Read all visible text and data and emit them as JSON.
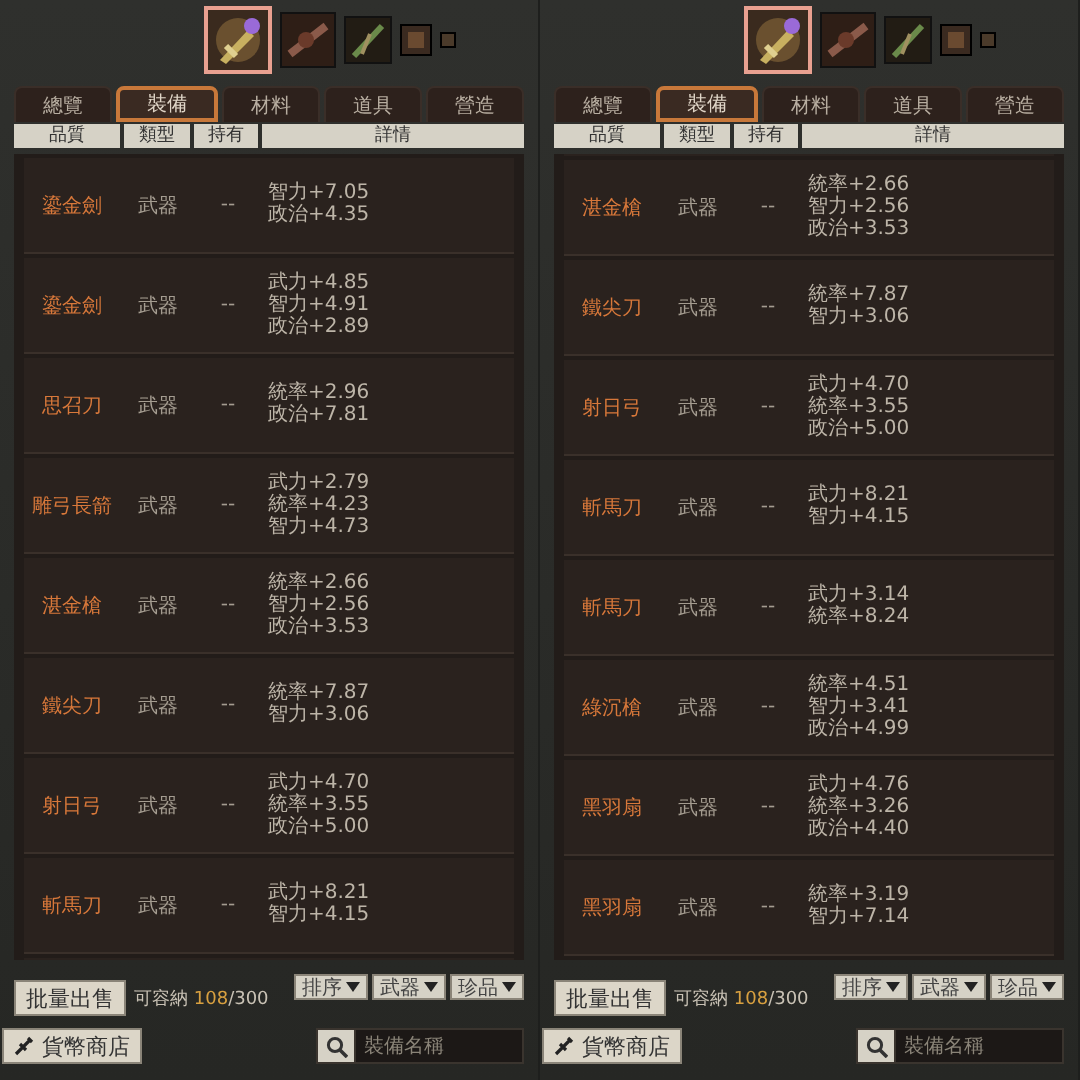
{
  "panels": [
    {
      "item_icons": [
        {
          "selected": true
        },
        {
          "selected": false
        },
        {
          "selected": false
        },
        {
          "selected": false
        },
        {
          "selected": false
        }
      ],
      "tabs": [
        {
          "label": "總覽",
          "selected": false
        },
        {
          "label": "裝備",
          "selected": true
        },
        {
          "label": "材料",
          "selected": false
        },
        {
          "label": "道具",
          "selected": false
        },
        {
          "label": "營造",
          "selected": false
        }
      ],
      "columns": [
        "品質",
        "類型",
        "持有",
        "詳情"
      ],
      "scrolled_to_end": false,
      "rows": [
        {
          "name": "鎏金劍",
          "type": "武器",
          "held": "--",
          "details": [
            "智力+7.05",
            "政治+4.35"
          ]
        },
        {
          "name": "鎏金劍",
          "type": "武器",
          "held": "--",
          "details": [
            "武力+4.85",
            "智力+4.91",
            "政治+2.89"
          ]
        },
        {
          "name": "思召刀",
          "type": "武器",
          "held": "--",
          "details": [
            "統率+2.96",
            "政治+7.81"
          ]
        },
        {
          "name": "雕弓長箭",
          "type": "武器",
          "held": "--",
          "details": [
            "武力+2.79",
            "統率+4.23",
            "智力+4.73"
          ]
        },
        {
          "name": "湛金槍",
          "type": "武器",
          "held": "--",
          "details": [
            "統率+2.66",
            "智力+2.56",
            "政治+3.53"
          ]
        },
        {
          "name": "鐵尖刀",
          "type": "武器",
          "held": "--",
          "details": [
            "統率+7.87",
            "智力+3.06"
          ]
        },
        {
          "name": "射日弓",
          "type": "武器",
          "held": "--",
          "details": [
            "武力+4.70",
            "統率+3.55",
            "政治+5.00"
          ]
        },
        {
          "name": "斬馬刀",
          "type": "武器",
          "held": "--",
          "details": [
            "武力+8.21",
            "智力+4.15"
          ]
        }
      ],
      "sell_button": "批量出售",
      "capacity_label": "可容納",
      "capacity_used": "108",
      "capacity_total": "/300",
      "filters": [
        "排序",
        "武器",
        "珍品"
      ],
      "shop_button": "貨幣商店",
      "search": {
        "placeholder": "裝備名稱"
      }
    },
    {
      "item_icons": [
        {
          "selected": true
        },
        {
          "selected": false
        },
        {
          "selected": false
        },
        {
          "selected": false
        },
        {
          "selected": false
        }
      ],
      "tabs": [
        {
          "label": "總覽",
          "selected": false
        },
        {
          "label": "裝備",
          "selected": true
        },
        {
          "label": "材料",
          "selected": false
        },
        {
          "label": "道具",
          "selected": false
        },
        {
          "label": "營造",
          "selected": false
        }
      ],
      "columns": [
        "品質",
        "類型",
        "持有",
        "詳情"
      ],
      "scrolled_to_end": true,
      "rows": [
        {
          "name": "湛金槍",
          "type": "武器",
          "held": "--",
          "details": [
            "統率+2.66",
            "智力+2.56",
            "政治+3.53"
          ]
        },
        {
          "name": "鐵尖刀",
          "type": "武器",
          "held": "--",
          "details": [
            "統率+7.87",
            "智力+3.06"
          ]
        },
        {
          "name": "射日弓",
          "type": "武器",
          "held": "--",
          "details": [
            "武力+4.70",
            "統率+3.55",
            "政治+5.00"
          ]
        },
        {
          "name": "斬馬刀",
          "type": "武器",
          "held": "--",
          "details": [
            "武力+8.21",
            "智力+4.15"
          ]
        },
        {
          "name": "斬馬刀",
          "type": "武器",
          "held": "--",
          "details": [
            "武力+3.14",
            "統率+8.24"
          ]
        },
        {
          "name": "綠沉槍",
          "type": "武器",
          "held": "--",
          "details": [
            "統率+4.51",
            "智力+3.41",
            "政治+4.99"
          ]
        },
        {
          "name": "黑羽扇",
          "type": "武器",
          "held": "--",
          "details": [
            "武力+4.76",
            "統率+3.26",
            "政治+4.40"
          ]
        },
        {
          "name": "黑羽扇",
          "type": "武器",
          "held": "--",
          "details": [
            "統率+3.19",
            "智力+7.14"
          ]
        }
      ],
      "sell_button": "批量出售",
      "capacity_label": "可容納",
      "capacity_used": "108",
      "capacity_total": "/300",
      "filters": [
        "排序",
        "武器",
        "珍品"
      ],
      "shop_button": "貨幣商店",
      "search": {
        "placeholder": "裝備名稱"
      }
    }
  ]
}
